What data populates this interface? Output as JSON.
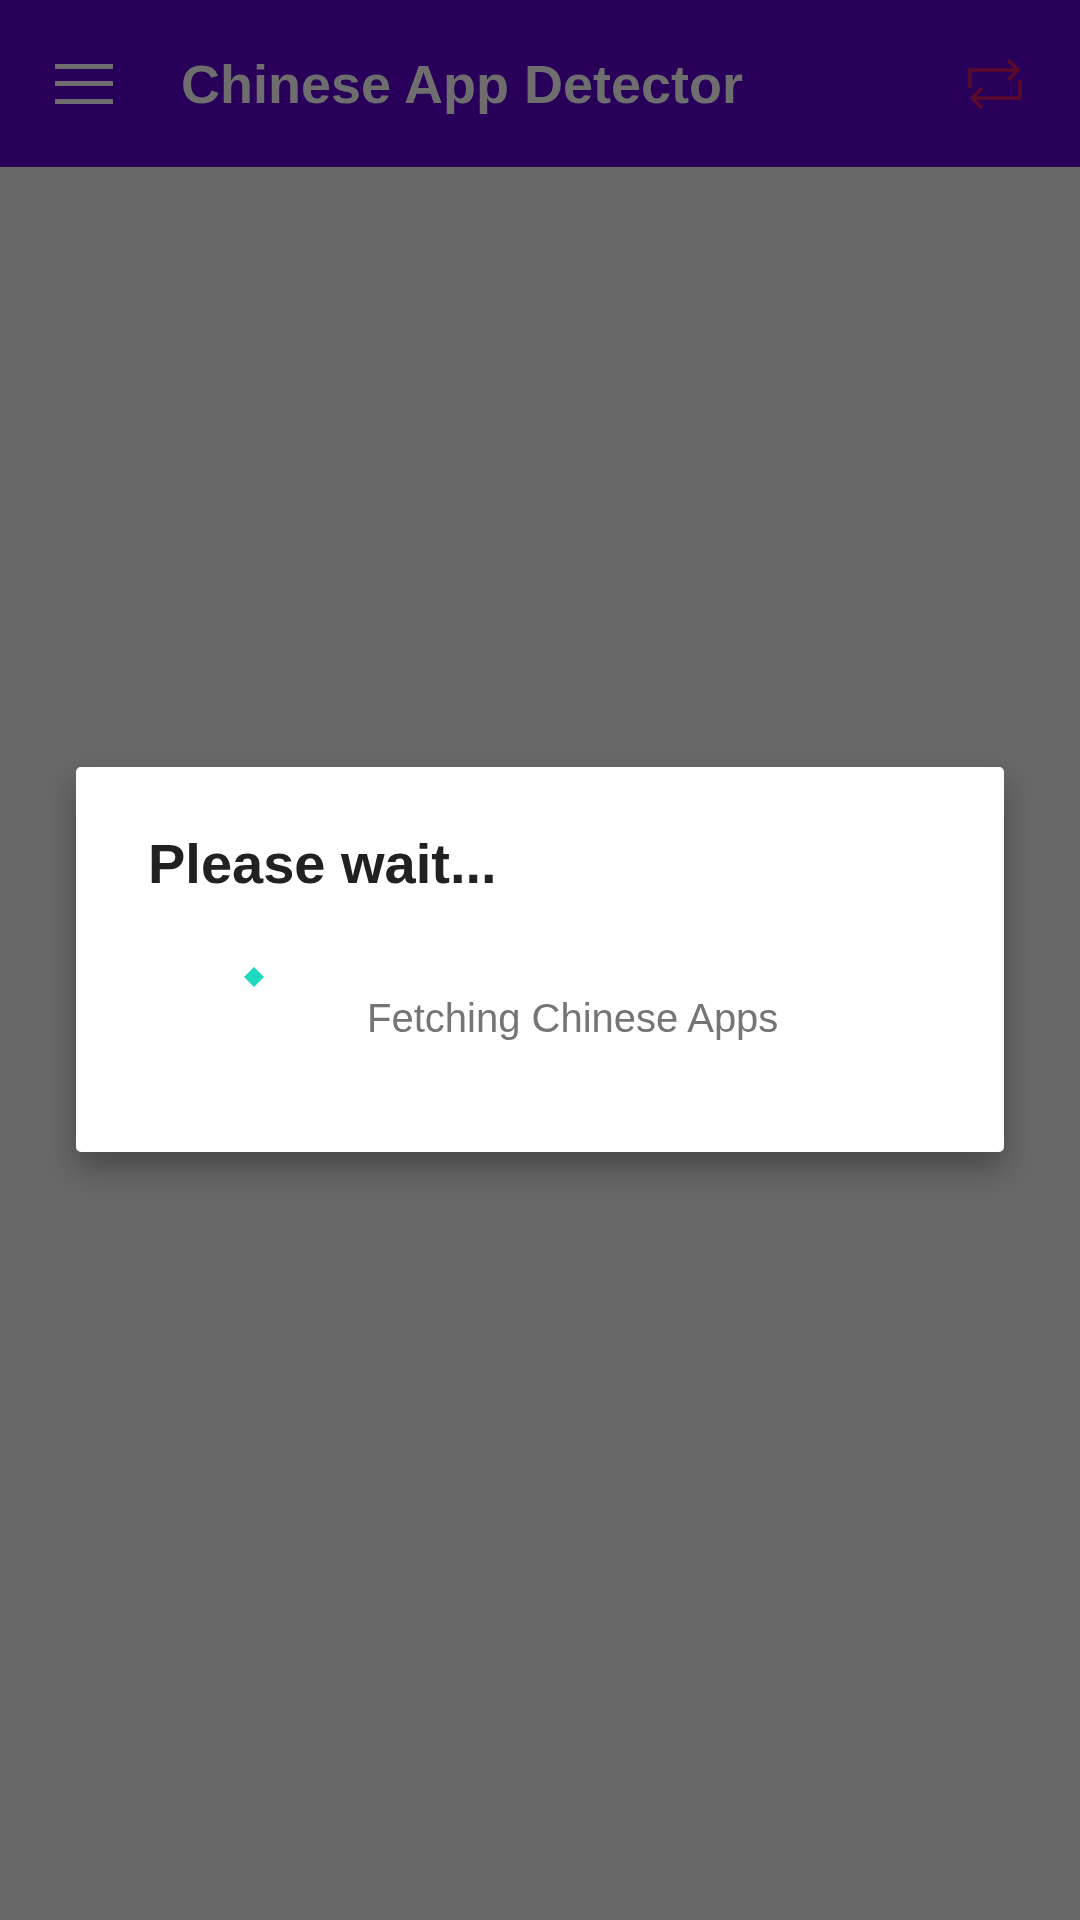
{
  "app_bar": {
    "title": "Chinese App Detector"
  },
  "dialog": {
    "title": "Please wait...",
    "message": "Fetching Chinese Apps"
  }
}
